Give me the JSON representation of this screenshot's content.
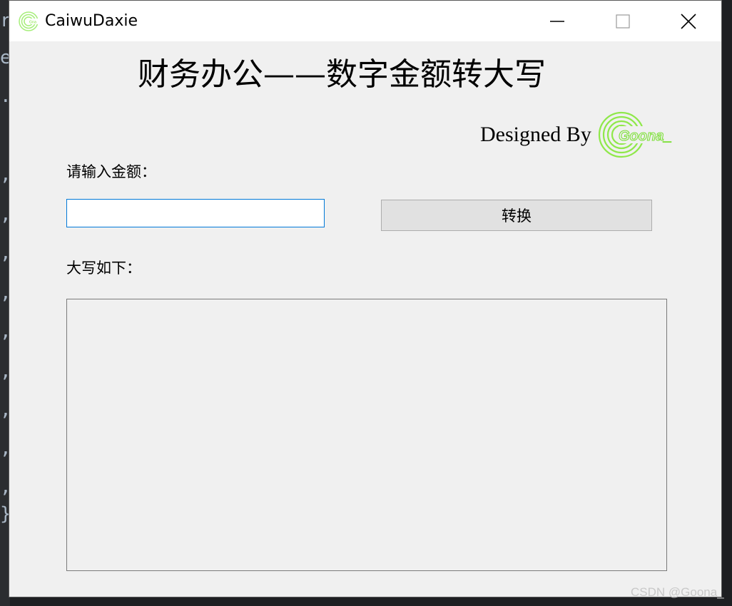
{
  "background_editor": {
    "glyphs": [
      "r",
      "e",
      ".",
      ",",
      ",",
      ",",
      ",",
      ",",
      ",",
      ",",
      ",",
      ",",
      "}"
    ]
  },
  "window": {
    "title": "CaiwuDaxie",
    "icon": "goona-app-icon",
    "controls": {
      "minimize_icon": "minimize-icon",
      "maximize_icon": "maximize-icon",
      "close_icon": "close-icon"
    }
  },
  "header": {
    "title": "财务办公——数字金额转大写",
    "designed_by": "Designed By",
    "logo_text": "Goona_",
    "logo_color": "#7ee03a"
  },
  "form": {
    "input_label": "请输入金额：",
    "input_value": "",
    "convert_button": "转换",
    "output_label": "大写如下：",
    "output_value": ""
  },
  "watermark": "CSDN @Goona_",
  "colors": {
    "window_bg": "#f0f0f0",
    "titlebar_bg": "#ffffff",
    "input_focus_border": "#0078d7",
    "button_bg": "#e1e1e1",
    "logo_green": "#7ee03a"
  }
}
